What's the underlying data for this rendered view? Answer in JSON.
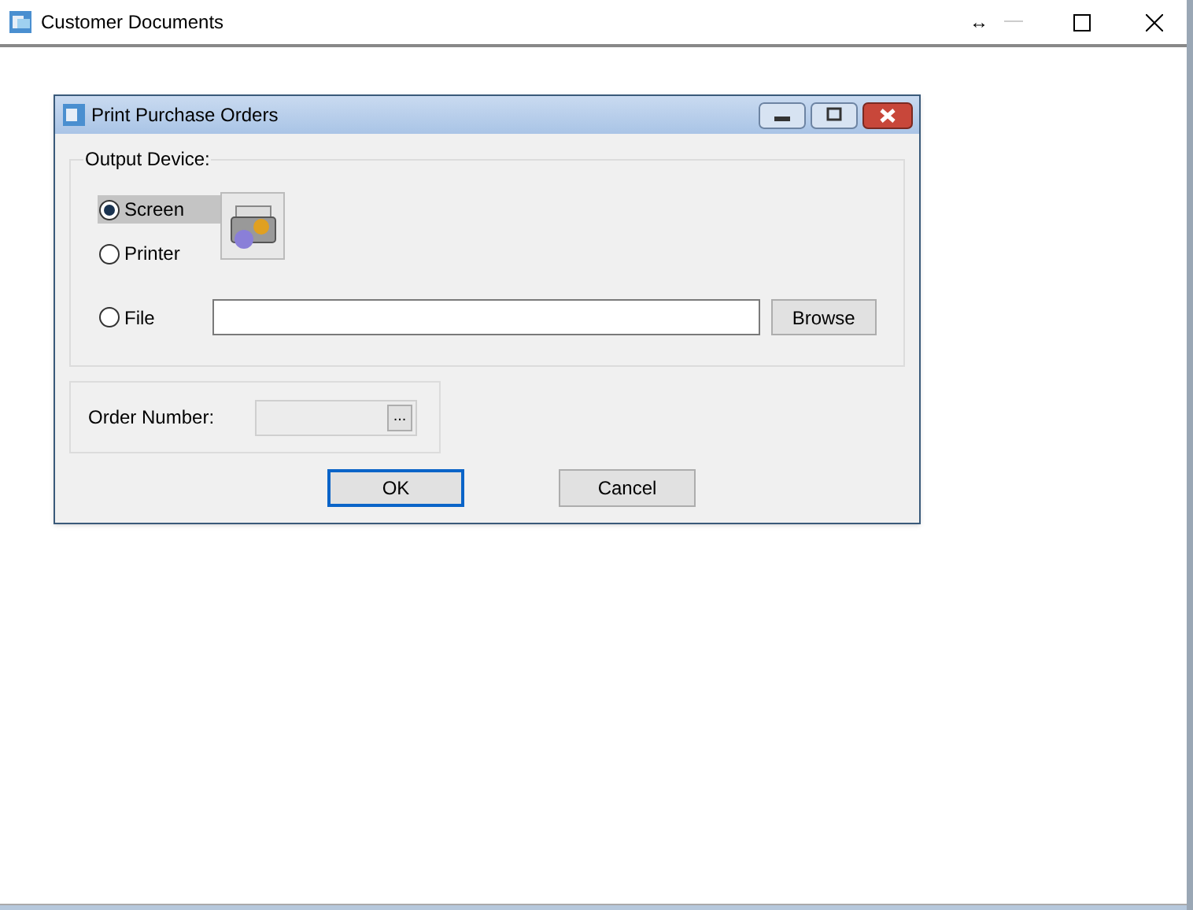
{
  "window": {
    "title": "Customer Documents",
    "resize_glyph": "↔"
  },
  "dialog": {
    "title": "Print Purchase Orders",
    "output_device": {
      "label": "Output Device:",
      "options": [
        {
          "label": "Screen",
          "selected": true
        },
        {
          "label": "Printer",
          "selected": false
        },
        {
          "label": "File",
          "selected": false
        }
      ],
      "browse_button": "Browse"
    },
    "order_number": {
      "label": "Order Number:",
      "disabled": true,
      "lookup_button": "..."
    },
    "buttons": [
      {
        "label": "OK",
        "focused": true
      },
      {
        "label": "Cancel",
        "focused": false
      }
    ]
  }
}
